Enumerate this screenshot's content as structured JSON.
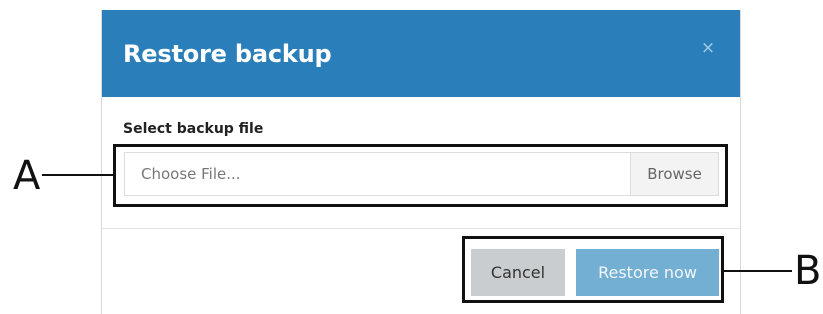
{
  "dialog": {
    "title": "Restore backup",
    "close_icon": "close-icon",
    "close_symbol": "×"
  },
  "file_field": {
    "label": "Select backup file",
    "placeholder": "Choose File...",
    "browse_label": "Browse"
  },
  "footer": {
    "cancel_label": "Cancel",
    "restore_label": "Restore now"
  },
  "callouts": {
    "a": "A",
    "b": "B"
  },
  "colors": {
    "header": "#2a7fba",
    "primary_button": "#73aed3",
    "secondary_button": "#c9cdd0"
  }
}
